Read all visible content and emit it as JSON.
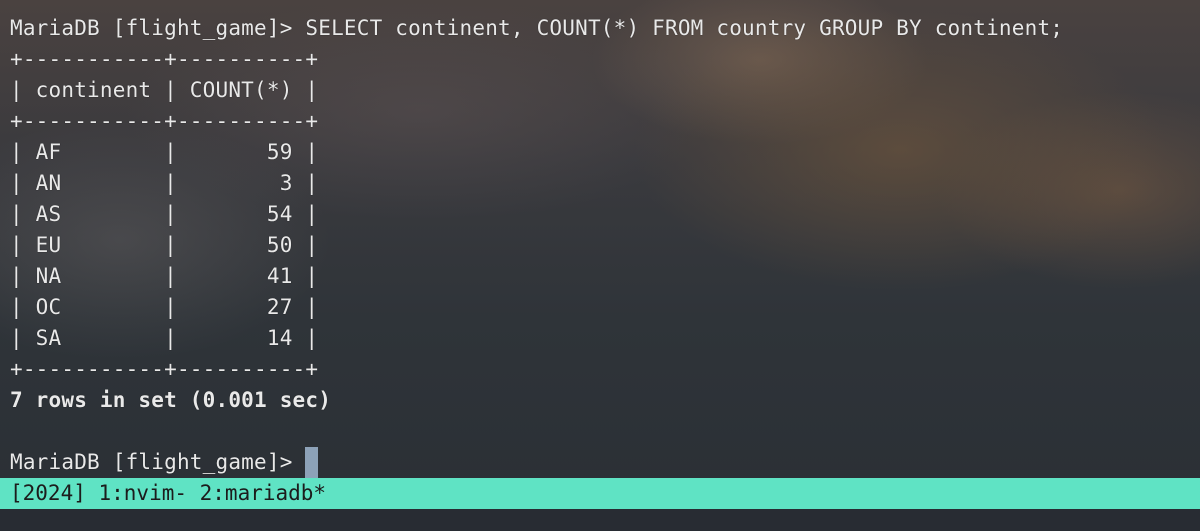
{
  "terminal": {
    "command_line": "MariaDB [flight_game]> SELECT continent, COUNT(*) FROM country GROUP BY continent;",
    "table_border": "+-----------+----------+",
    "table_header": "| continent | COUNT(*) |",
    "rows": [
      "| AF        |       59 |",
      "| AN        |        3 |",
      "| AS        |       54 |",
      "| EU        |       50 |",
      "| NA        |       41 |",
      "| OC        |       27 |",
      "| SA        |       14 |"
    ],
    "result_summary": "7 rows in set (0.001 sec)",
    "prompt": "MariaDB [flight_game]> "
  },
  "statusbar": {
    "text": "[2024] 1:nvim- 2:mariadb*",
    "background": "#5fe3c4"
  },
  "colors": {
    "text": "#e9e9e9",
    "cursor": "#8da2b8"
  }
}
